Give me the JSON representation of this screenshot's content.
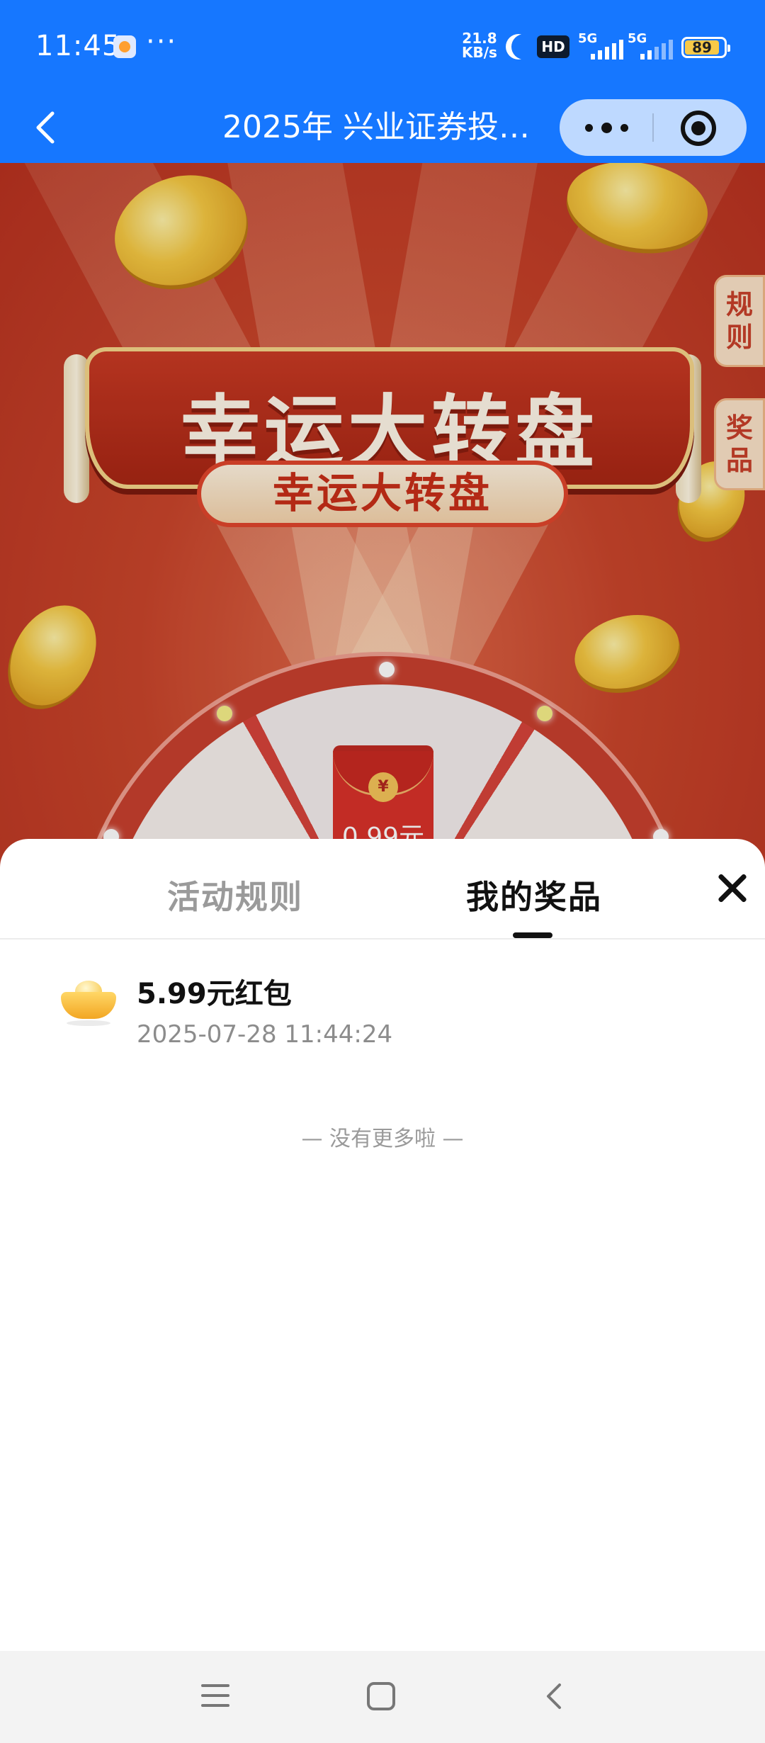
{
  "status_bar": {
    "time": "11:45",
    "more": "···",
    "net_speed_value": "21.8",
    "net_speed_unit": "KB/s",
    "hd_label": "HD",
    "sim1_label": "5G",
    "sim2_label": "5G",
    "battery": "89"
  },
  "nav": {
    "title": "2025年 兴业证券投…"
  },
  "banner": {
    "title": "幸运大转盘",
    "subtitle": "幸运大转盘",
    "rules_tab": "规则",
    "prizes_tab": "奖品",
    "wheel_prize_amount": "0.99元",
    "wheel_prize_seal": "¥"
  },
  "sheet": {
    "tabs": [
      {
        "label": "活动规则",
        "active": false
      },
      {
        "label": "我的奖品",
        "active": true
      }
    ],
    "prizes": [
      {
        "name": "5.99元红包",
        "time": "2025-07-28 11:44:24",
        "icon": "gold-ingot-icon"
      }
    ],
    "no_more": "— 没有更多啦 —"
  },
  "colors": {
    "brand_blue": "#1677ff",
    "banner_red": "#c9452b",
    "text_dark": "#111111",
    "text_grey": "#9a9a9a"
  }
}
